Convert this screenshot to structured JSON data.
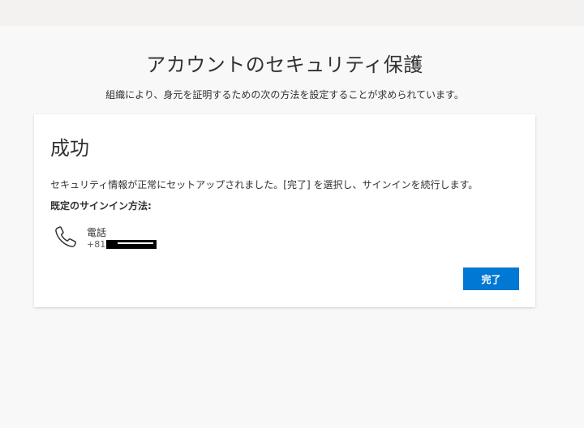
{
  "page": {
    "title": "アカウントのセキュリティ保護",
    "subtitle": "組織により、身元を証明するための次の方法を設定することが求められています。"
  },
  "card": {
    "heading": "成功",
    "message": "セキュリティ情報が正常にセットアップされました。[完了] を選択し、サインインを続行します。",
    "default_method_label": "既定のサインイン方法:",
    "method": {
      "icon": "phone-icon",
      "name": "電話",
      "number_prefix": "+81"
    },
    "done_button_label": "完了"
  },
  "colors": {
    "accent": "#0078d4",
    "background": "#f8f8f8",
    "card": "#ffffff",
    "text": "#323130"
  }
}
